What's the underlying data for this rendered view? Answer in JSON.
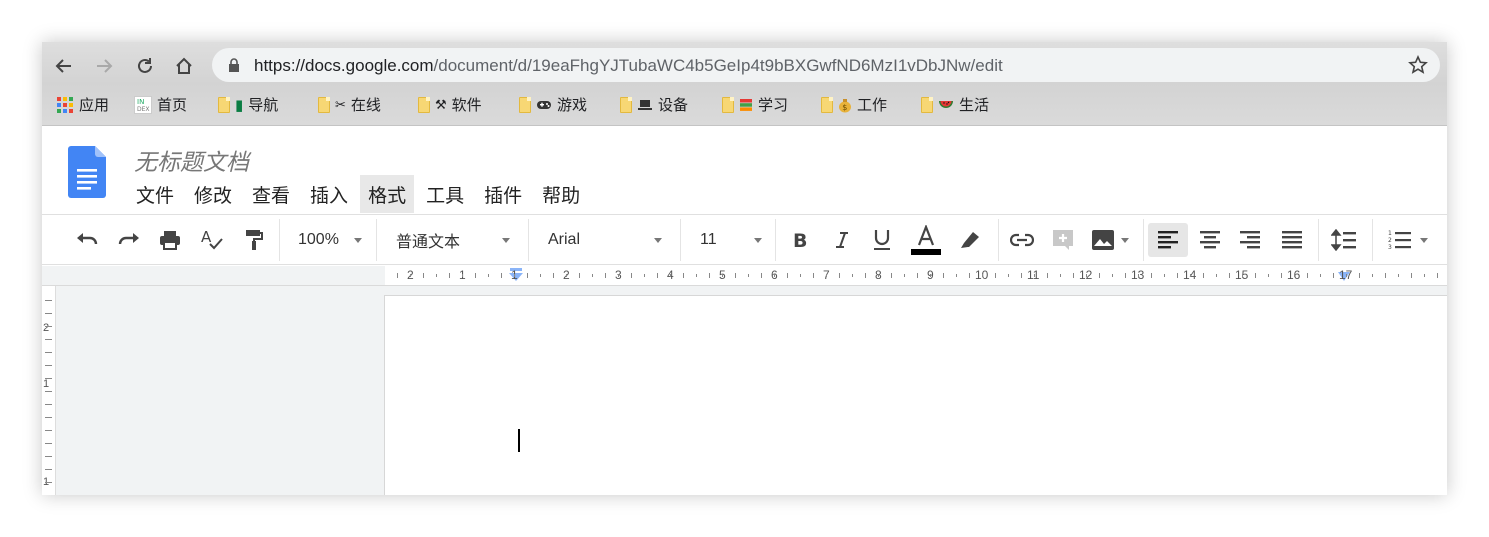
{
  "browser": {
    "url_host": "https://docs.google.com",
    "url_path": "/document/d/19eaFhgYJTubaWC4b5GeIp4t9bBXGwfND6MzI1vDbJNw/edit",
    "bookmarks": [
      {
        "label": "应用",
        "icon": "apps-grid-icon"
      },
      {
        "label": "首页",
        "icon": "index-icon"
      },
      {
        "label": "导航",
        "icon": "book-icon"
      },
      {
        "label": "在线",
        "icon": "scissors-icon"
      },
      {
        "label": "软件",
        "icon": "hammer-icon"
      },
      {
        "label": "游戏",
        "icon": "gamepad-icon"
      },
      {
        "label": "设备",
        "icon": "laptop-icon"
      },
      {
        "label": "学习",
        "icon": "books-icon"
      },
      {
        "label": "工作",
        "icon": "money-bag-icon"
      },
      {
        "label": "生活",
        "icon": "watermelon-icon"
      }
    ]
  },
  "docs": {
    "title": "无标题文档",
    "menu": [
      "文件",
      "修改",
      "查看",
      "插入",
      "格式",
      "工具",
      "插件",
      "帮助"
    ],
    "active_menu": "格式"
  },
  "toolbar": {
    "zoom": "100%",
    "style": "普通文本",
    "font": "Arial",
    "font_size": "11",
    "text_color": "#000000"
  },
  "ruler": {
    "labels": [
      "2",
      "1",
      "1",
      "2",
      "3",
      "4",
      "5",
      "6",
      "7",
      "8",
      "9",
      "10",
      "11",
      "12",
      "13",
      "14",
      "15",
      "16",
      "17"
    ]
  },
  "vertical_ruler": {
    "labels": [
      "2",
      "1",
      "1"
    ]
  },
  "colors": {
    "docs_blue": "#4285f4",
    "ruler_marker": "#8ab4f8"
  }
}
